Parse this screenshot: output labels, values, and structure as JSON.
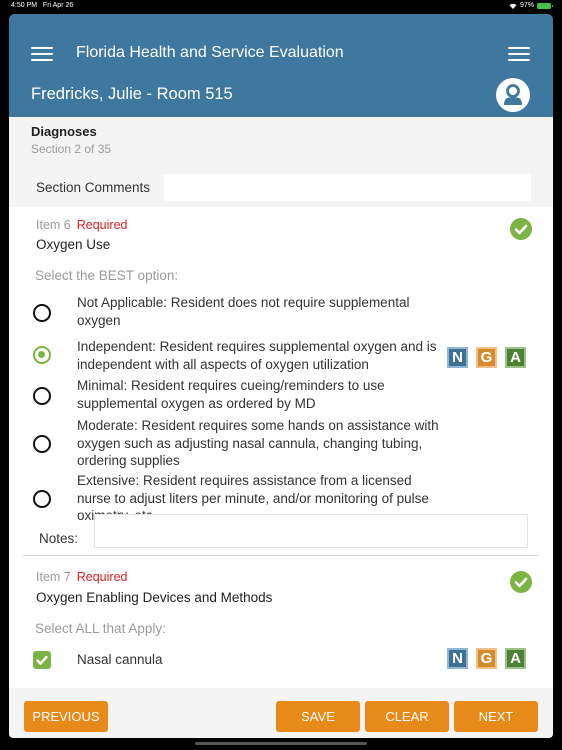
{
  "status_bar": {
    "time": "4:50 PM",
    "date": "Fri Apr 26",
    "battery_percent": "97%",
    "icons": [
      "wifi-icon",
      "battery-icon"
    ]
  },
  "header": {
    "title": "Florida Health and Service Evaluation",
    "resident": "Fredricks, Julie - Room 515",
    "icons": [
      "menu-icon",
      "menu-icon",
      "user-avatar-icon"
    ]
  },
  "section": {
    "title": "Diagnoses",
    "progress": "Section 2 of 35",
    "comments_label": "Section Comments",
    "comments_value": ""
  },
  "items": [
    {
      "number": "Item 6",
      "required": "Required",
      "question": "Oxygen Use",
      "instruction": "Select the BEST option:",
      "complete": true,
      "options": [
        {
          "text": "Not Applicable: Resident does not require supplemental oxygen",
          "selected": false
        },
        {
          "text": "Independent: Resident requires supplemental oxygen and is independent with all aspects of oxygen utilization",
          "selected": true
        },
        {
          "text": "Minimal: Resident requires cueing/reminders to use supplemental oxygen as ordered by MD",
          "selected": false
        },
        {
          "text": "Moderate: Resident requires some hands on assistance with oxygen such as adjusting nasal cannula, changing tubing, ordering supplies",
          "selected": false
        },
        {
          "text": "Extensive: Resident requires assistance from a licensed nurse to adjust liters per minute, and/or monitoring of pulse oximetry, etc.",
          "selected": false
        }
      ],
      "badges": [
        "N",
        "G",
        "A"
      ],
      "notes_label": "Notes:",
      "notes_value": ""
    },
    {
      "number": "Item 7",
      "required": "Required",
      "question": "Oxygen Enabling Devices and Methods",
      "instruction": "Select ALL that Apply:",
      "complete": true,
      "options": [
        {
          "text": "Nasal cannula",
          "checked": true
        }
      ],
      "badges": [
        "N",
        "G",
        "A"
      ]
    }
  ],
  "footer": {
    "previous": "PREVIOUS",
    "save": "SAVE",
    "clear": "CLEAR",
    "next": "NEXT"
  },
  "colors": {
    "header_bg": "#3f789e",
    "accent_green": "#7cb443",
    "required_red": "#e02020",
    "button_orange": "#e88a1a",
    "badge_n": "#3d7196",
    "badge_g": "#d68b2c",
    "badge_a": "#4f8135"
  }
}
